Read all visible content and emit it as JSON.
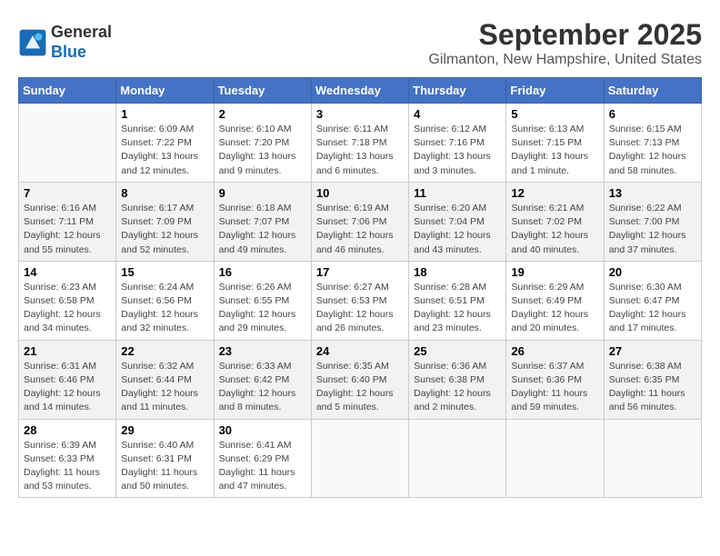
{
  "app": {
    "logo_line1": "General",
    "logo_line2": "Blue"
  },
  "header": {
    "month": "September 2025",
    "location": "Gilmanton, New Hampshire, United States"
  },
  "columns": [
    "Sunday",
    "Monday",
    "Tuesday",
    "Wednesday",
    "Thursday",
    "Friday",
    "Saturday"
  ],
  "weeks": [
    [
      {
        "day": "",
        "sunrise": "",
        "sunset": "",
        "daylight": ""
      },
      {
        "day": "1",
        "sunrise": "Sunrise: 6:09 AM",
        "sunset": "Sunset: 7:22 PM",
        "daylight": "Daylight: 13 hours and 12 minutes."
      },
      {
        "day": "2",
        "sunrise": "Sunrise: 6:10 AM",
        "sunset": "Sunset: 7:20 PM",
        "daylight": "Daylight: 13 hours and 9 minutes."
      },
      {
        "day": "3",
        "sunrise": "Sunrise: 6:11 AM",
        "sunset": "Sunset: 7:18 PM",
        "daylight": "Daylight: 13 hours and 6 minutes."
      },
      {
        "day": "4",
        "sunrise": "Sunrise: 6:12 AM",
        "sunset": "Sunset: 7:16 PM",
        "daylight": "Daylight: 13 hours and 3 minutes."
      },
      {
        "day": "5",
        "sunrise": "Sunrise: 6:13 AM",
        "sunset": "Sunset: 7:15 PM",
        "daylight": "Daylight: 13 hours and 1 minute."
      },
      {
        "day": "6",
        "sunrise": "Sunrise: 6:15 AM",
        "sunset": "Sunset: 7:13 PM",
        "daylight": "Daylight: 12 hours and 58 minutes."
      }
    ],
    [
      {
        "day": "7",
        "sunrise": "Sunrise: 6:16 AM",
        "sunset": "Sunset: 7:11 PM",
        "daylight": "Daylight: 12 hours and 55 minutes."
      },
      {
        "day": "8",
        "sunrise": "Sunrise: 6:17 AM",
        "sunset": "Sunset: 7:09 PM",
        "daylight": "Daylight: 12 hours and 52 minutes."
      },
      {
        "day": "9",
        "sunrise": "Sunrise: 6:18 AM",
        "sunset": "Sunset: 7:07 PM",
        "daylight": "Daylight: 12 hours and 49 minutes."
      },
      {
        "day": "10",
        "sunrise": "Sunrise: 6:19 AM",
        "sunset": "Sunset: 7:06 PM",
        "daylight": "Daylight: 12 hours and 46 minutes."
      },
      {
        "day": "11",
        "sunrise": "Sunrise: 6:20 AM",
        "sunset": "Sunset: 7:04 PM",
        "daylight": "Daylight: 12 hours and 43 minutes."
      },
      {
        "day": "12",
        "sunrise": "Sunrise: 6:21 AM",
        "sunset": "Sunset: 7:02 PM",
        "daylight": "Daylight: 12 hours and 40 minutes."
      },
      {
        "day": "13",
        "sunrise": "Sunrise: 6:22 AM",
        "sunset": "Sunset: 7:00 PM",
        "daylight": "Daylight: 12 hours and 37 minutes."
      }
    ],
    [
      {
        "day": "14",
        "sunrise": "Sunrise: 6:23 AM",
        "sunset": "Sunset: 6:58 PM",
        "daylight": "Daylight: 12 hours and 34 minutes."
      },
      {
        "day": "15",
        "sunrise": "Sunrise: 6:24 AM",
        "sunset": "Sunset: 6:56 PM",
        "daylight": "Daylight: 12 hours and 32 minutes."
      },
      {
        "day": "16",
        "sunrise": "Sunrise: 6:26 AM",
        "sunset": "Sunset: 6:55 PM",
        "daylight": "Daylight: 12 hours and 29 minutes."
      },
      {
        "day": "17",
        "sunrise": "Sunrise: 6:27 AM",
        "sunset": "Sunset: 6:53 PM",
        "daylight": "Daylight: 12 hours and 26 minutes."
      },
      {
        "day": "18",
        "sunrise": "Sunrise: 6:28 AM",
        "sunset": "Sunset: 6:51 PM",
        "daylight": "Daylight: 12 hours and 23 minutes."
      },
      {
        "day": "19",
        "sunrise": "Sunrise: 6:29 AM",
        "sunset": "Sunset: 6:49 PM",
        "daylight": "Daylight: 12 hours and 20 minutes."
      },
      {
        "day": "20",
        "sunrise": "Sunrise: 6:30 AM",
        "sunset": "Sunset: 6:47 PM",
        "daylight": "Daylight: 12 hours and 17 minutes."
      }
    ],
    [
      {
        "day": "21",
        "sunrise": "Sunrise: 6:31 AM",
        "sunset": "Sunset: 6:46 PM",
        "daylight": "Daylight: 12 hours and 14 minutes."
      },
      {
        "day": "22",
        "sunrise": "Sunrise: 6:32 AM",
        "sunset": "Sunset: 6:44 PM",
        "daylight": "Daylight: 12 hours and 11 minutes."
      },
      {
        "day": "23",
        "sunrise": "Sunrise: 6:33 AM",
        "sunset": "Sunset: 6:42 PM",
        "daylight": "Daylight: 12 hours and 8 minutes."
      },
      {
        "day": "24",
        "sunrise": "Sunrise: 6:35 AM",
        "sunset": "Sunset: 6:40 PM",
        "daylight": "Daylight: 12 hours and 5 minutes."
      },
      {
        "day": "25",
        "sunrise": "Sunrise: 6:36 AM",
        "sunset": "Sunset: 6:38 PM",
        "daylight": "Daylight: 12 hours and 2 minutes."
      },
      {
        "day": "26",
        "sunrise": "Sunrise: 6:37 AM",
        "sunset": "Sunset: 6:36 PM",
        "daylight": "Daylight: 11 hours and 59 minutes."
      },
      {
        "day": "27",
        "sunrise": "Sunrise: 6:38 AM",
        "sunset": "Sunset: 6:35 PM",
        "daylight": "Daylight: 11 hours and 56 minutes."
      }
    ],
    [
      {
        "day": "28",
        "sunrise": "Sunrise: 6:39 AM",
        "sunset": "Sunset: 6:33 PM",
        "daylight": "Daylight: 11 hours and 53 minutes."
      },
      {
        "day": "29",
        "sunrise": "Sunrise: 6:40 AM",
        "sunset": "Sunset: 6:31 PM",
        "daylight": "Daylight: 11 hours and 50 minutes."
      },
      {
        "day": "30",
        "sunrise": "Sunrise: 6:41 AM",
        "sunset": "Sunset: 6:29 PM",
        "daylight": "Daylight: 11 hours and 47 minutes."
      },
      {
        "day": "",
        "sunrise": "",
        "sunset": "",
        "daylight": ""
      },
      {
        "day": "",
        "sunrise": "",
        "sunset": "",
        "daylight": ""
      },
      {
        "day": "",
        "sunrise": "",
        "sunset": "",
        "daylight": ""
      },
      {
        "day": "",
        "sunrise": "",
        "sunset": "",
        "daylight": ""
      }
    ]
  ]
}
